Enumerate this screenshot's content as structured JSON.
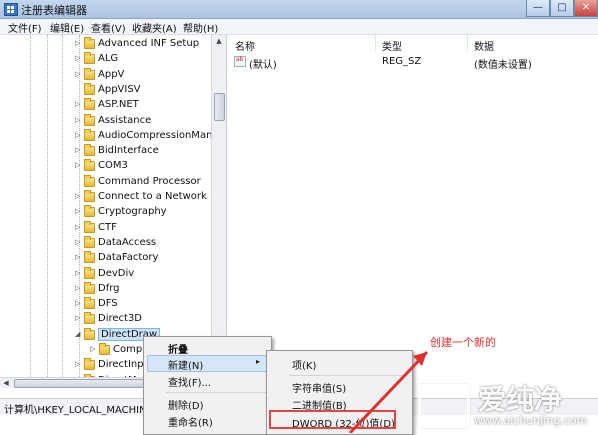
{
  "window": {
    "title": "注册表编辑器",
    "min": "—",
    "max": "□",
    "close": "✕"
  },
  "menu": [
    "文件(F)",
    "编辑(E)",
    "查看(V)",
    "收藏夹(A)",
    "帮助(H)"
  ],
  "tree": {
    "items": [
      {
        "label": "Advanced INF Setup",
        "exp": "▷"
      },
      {
        "label": "ALG",
        "exp": "▷"
      },
      {
        "label": "AppV",
        "exp": "▷"
      },
      {
        "label": "AppVISV",
        "exp": ""
      },
      {
        "label": "ASP.NET",
        "exp": "▷"
      },
      {
        "label": "Assistance",
        "exp": "▷"
      },
      {
        "label": "AudioCompressionManag",
        "exp": "▷"
      },
      {
        "label": "BidInterface",
        "exp": "▷"
      },
      {
        "label": "COM3",
        "exp": "▷"
      },
      {
        "label": "Command Processor",
        "exp": ""
      },
      {
        "label": "Connect to a Network Pro",
        "exp": "▷"
      },
      {
        "label": "Cryptography",
        "exp": "▷"
      },
      {
        "label": "CTF",
        "exp": "▷"
      },
      {
        "label": "DataAccess",
        "exp": "▷"
      },
      {
        "label": "DataFactory",
        "exp": "▷"
      },
      {
        "label": "DevDiv",
        "exp": "▷"
      },
      {
        "label": "Dfrg",
        "exp": "▷"
      },
      {
        "label": "DFS",
        "exp": "▷"
      },
      {
        "label": "Direct3D",
        "exp": "▷"
      },
      {
        "label": "DirectDraw",
        "exp": "◢"
      },
      {
        "label": "Compa",
        "exp": "▷"
      },
      {
        "label": "DirectInput",
        "exp": "▷"
      },
      {
        "label": "DirectMusic",
        "exp": "▷"
      }
    ]
  },
  "list": {
    "headers": {
      "name": "名称",
      "type": "类型",
      "data": "数据"
    },
    "rows": [
      {
        "icon": "ab",
        "name": "(默认)",
        "type": "REG_SZ",
        "data": "(数值未设置)"
      }
    ]
  },
  "status": "计算机\\HKEY_LOCAL_MACHINE",
  "context_menu": [
    "折叠",
    "新建(N)",
    "查找(F)...",
    "删除(D)",
    "重命名(R)"
  ],
  "context_arrow": "▸",
  "submenu": [
    "项(K)",
    "字符串值(S)",
    "二进制值(B)",
    "DWORD (32-位)值(D)"
  ],
  "annotation": "创建一个新的",
  "watermark": {
    "title": "爱纯净",
    "url": "www.aichunjing.com"
  },
  "colors": {
    "annotation": "#e03030",
    "highlight": "#d5e6f8",
    "selection": "#cde3fb"
  }
}
